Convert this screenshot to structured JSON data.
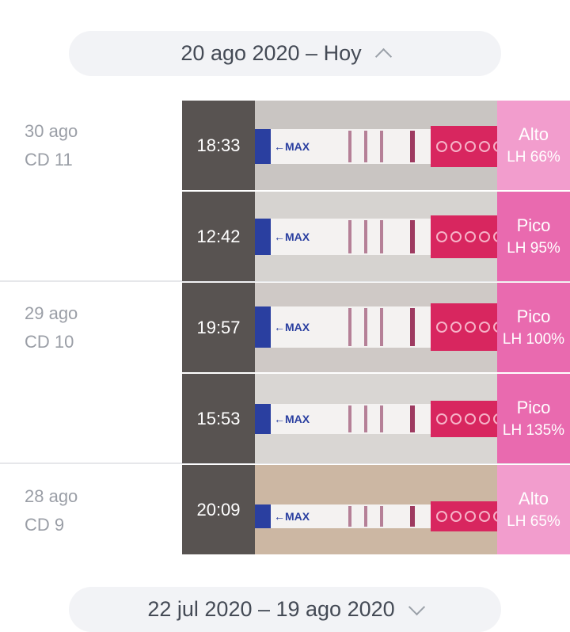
{
  "header_range": {
    "label": "20 ago 2020 – Hoy",
    "icon": "chevron-up-icon"
  },
  "footer_range": {
    "label": "22 jul 2020 – 19 ago 2020",
    "icon": "chevron-down-icon"
  },
  "colors": {
    "high": "#f29dcd",
    "peak": "#e96aaf",
    "time_bg": "#585351"
  },
  "days": [
    {
      "date": "30 ago",
      "cycle_day": "CD 11"
    },
    {
      "date": "29 ago",
      "cycle_day": "CD 10"
    },
    {
      "date": "28 ago",
      "cycle_day": "CD 9"
    }
  ],
  "tests": [
    {
      "time": "18:33",
      "level": "Alto",
      "lh": "LH 66%",
      "status": "high"
    },
    {
      "time": "12:42",
      "level": "Pico",
      "lh": "LH 95%",
      "status": "peak"
    },
    {
      "time": "19:57",
      "level": "Pico",
      "lh": "LH 100%",
      "status": "peak"
    },
    {
      "time": "15:53",
      "level": "Pico",
      "lh": "LH 135%",
      "status": "peak"
    },
    {
      "time": "20:09",
      "level": "Alto",
      "lh": "LH 65%",
      "status": "high"
    }
  ],
  "strip_marking": "MAX"
}
